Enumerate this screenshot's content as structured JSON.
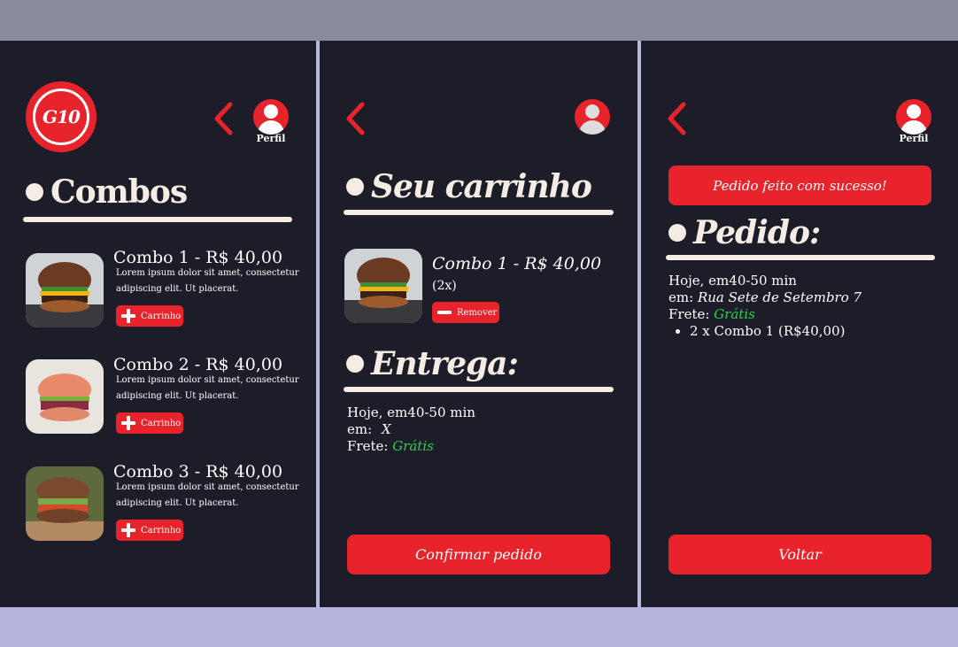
{
  "colors": {
    "accent": "#e8232b",
    "background": "#1d1d29",
    "cream": "#f5ede4",
    "green": "#2ad150"
  },
  "logo": {
    "text": "G10"
  },
  "profile": {
    "label": "Perfil"
  },
  "menu": {
    "title": "Combos",
    "items": [
      {
        "title": "Combo 1 - R$ 40,00",
        "desc": "Lorem ipsum dolor sit amet, consectetur adipiscing elit. Ut placerat.",
        "button": "Carrinho"
      },
      {
        "title": "Combo 2 - R$ 40,00",
        "desc": "Lorem ipsum dolor sit amet, consectetur adipiscing elit. Ut placerat.",
        "button": "Carrinho"
      },
      {
        "title": "Combo 3 - R$ 40,00",
        "desc": "Lorem ipsum dolor sit amet, consectetur adipiscing elit. Ut placerat.",
        "button": "Carrinho"
      }
    ]
  },
  "cart": {
    "title": "Seu carrinho",
    "item": {
      "title": "Combo 1 - R$ 40,00",
      "qty": "(2x)",
      "remove": "Remover"
    },
    "delivery_title": "Entrega:",
    "when": "Hoje, em40-50 min",
    "where_label": "em:",
    "where_value": "X",
    "freight_label": "Frete:",
    "freight_value": "Grátis",
    "confirm": "Confirmar pedido"
  },
  "order": {
    "toast": "Pedido feito com sucesso!",
    "title": "Pedido:",
    "when": "Hoje, em40-50 min",
    "where_label": "em:",
    "where_value": "Rua Sete de Setembro 7",
    "freight_label": "Frete:",
    "freight_value": "Grátis",
    "items": [
      "2 x Combo 1 (R$40,00)"
    ],
    "back": "Voltar"
  }
}
